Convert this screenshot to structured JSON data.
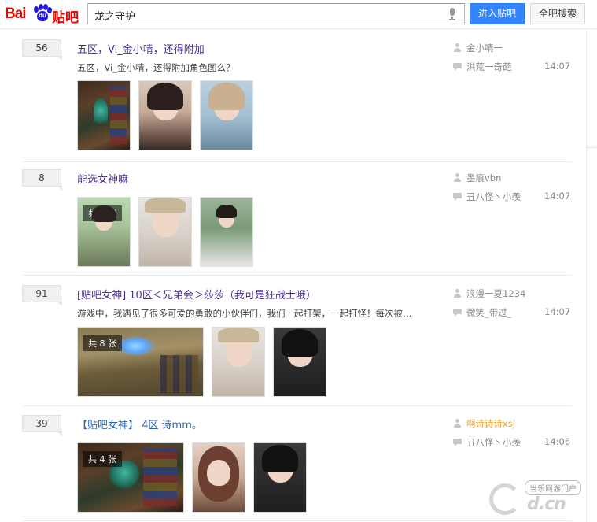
{
  "header": {
    "logo_text": "Bai du 贴吧",
    "search_value": "龙之守护",
    "enter_bar_label": "进入贴吧",
    "search_all_label": "全吧搜索"
  },
  "threads": [
    {
      "reply_count": "56",
      "title": "五区，Vi_金小啨，还得附加",
      "abstract": "五区，Vi_金小啨，还得附加角色图么？",
      "author": "金小啨一",
      "last_replier": "洪荒一奇葩",
      "time": "14:07"
    },
    {
      "reply_count": "8",
      "title": "能选女神嘛",
      "abstract": "",
      "author": "墨痕vbn",
      "last_replier": "丑八怪丶小羡",
      "time": "14:07",
      "image_badge": "共 7 张"
    },
    {
      "reply_count": "91",
      "title": "[贴吧女神] 10区＜兄弟会＞莎莎（我可是狂战士哦）",
      "abstract": "游戏中，我遇见了很多可爱的勇敢的小伙伴们，我们一起打架，一起打怪！每次被…",
      "author": "浪漫一夏1234",
      "last_replier": "微笑_带过_",
      "time": "14:07",
      "image_badge": "共 8 张"
    },
    {
      "reply_count": "39",
      "title": "【贴吧女神】 4区 诗mm。",
      "abstract": "",
      "author": "啊诗诗诗xsj",
      "last_replier": "丑八怪丶小羡",
      "time": "14:06",
      "image_badge": "共 4 张"
    }
  ],
  "watermark": {
    "tag": "当乐网游门户",
    "domain": "d.cn"
  },
  "colors": {
    "accent_blue": "#3385ff",
    "title_blue": "#2d64b3",
    "title_purple": "#4b2f8f",
    "author_orange": "#e8a030"
  }
}
